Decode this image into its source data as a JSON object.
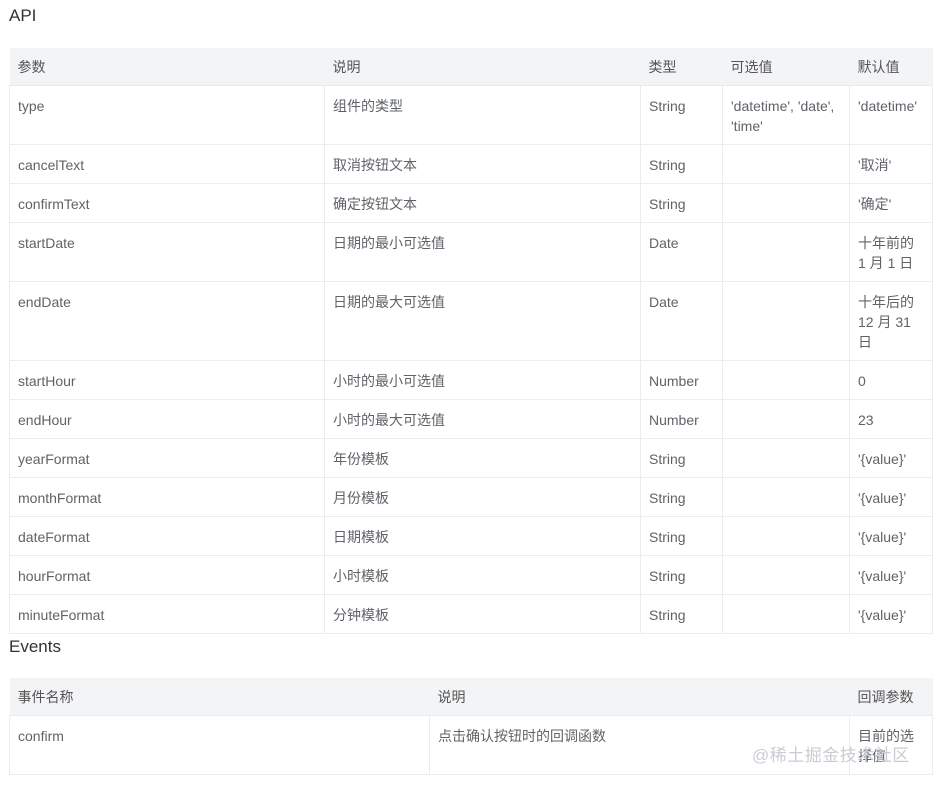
{
  "api": {
    "title": "API",
    "headers": [
      "参数",
      "说明",
      "类型",
      "可选值",
      "默认值"
    ],
    "rows": [
      {
        "param": "type",
        "desc": "组件的类型",
        "type": "String",
        "options": "'datetime', 'date', 'time'",
        "default": "'datetime'"
      },
      {
        "param": "cancelText",
        "desc": "取消按钮文本",
        "type": "String",
        "options": "",
        "default": "'取消'"
      },
      {
        "param": "confirmText",
        "desc": "确定按钮文本",
        "type": "String",
        "options": "",
        "default": "'确定'"
      },
      {
        "param": "startDate",
        "desc": "日期的最小可选值",
        "type": "Date",
        "options": "",
        "default": "十年前的 1 月 1 日"
      },
      {
        "param": "endDate",
        "desc": "日期的最大可选值",
        "type": "Date",
        "options": "",
        "default": "十年后的 12 月 31 日"
      },
      {
        "param": "startHour",
        "desc": "小时的最小可选值",
        "type": "Number",
        "options": "",
        "default": "0"
      },
      {
        "param": "endHour",
        "desc": "小时的最大可选值",
        "type": "Number",
        "options": "",
        "default": "23"
      },
      {
        "param": "yearFormat",
        "desc": "年份模板",
        "type": "String",
        "options": "",
        "default": "'{value}'"
      },
      {
        "param": "monthFormat",
        "desc": "月份模板",
        "type": "String",
        "options": "",
        "default": "'{value}'"
      },
      {
        "param": "dateFormat",
        "desc": "日期模板",
        "type": "String",
        "options": "",
        "default": "'{value}'"
      },
      {
        "param": "hourFormat",
        "desc": "小时模板",
        "type": "String",
        "options": "",
        "default": "'{value}'"
      },
      {
        "param": "minuteFormat",
        "desc": "分钟模板",
        "type": "String",
        "options": "",
        "default": "'{value}'"
      }
    ]
  },
  "events": {
    "title": "Events",
    "headers": [
      "事件名称",
      "说明",
      "回调参数"
    ],
    "rows": [
      {
        "name": "confirm",
        "desc": "点击确认按钮时的回调函数",
        "callback": "目前的选择值"
      }
    ]
  },
  "watermark": "@稀土掘金技术社区"
}
